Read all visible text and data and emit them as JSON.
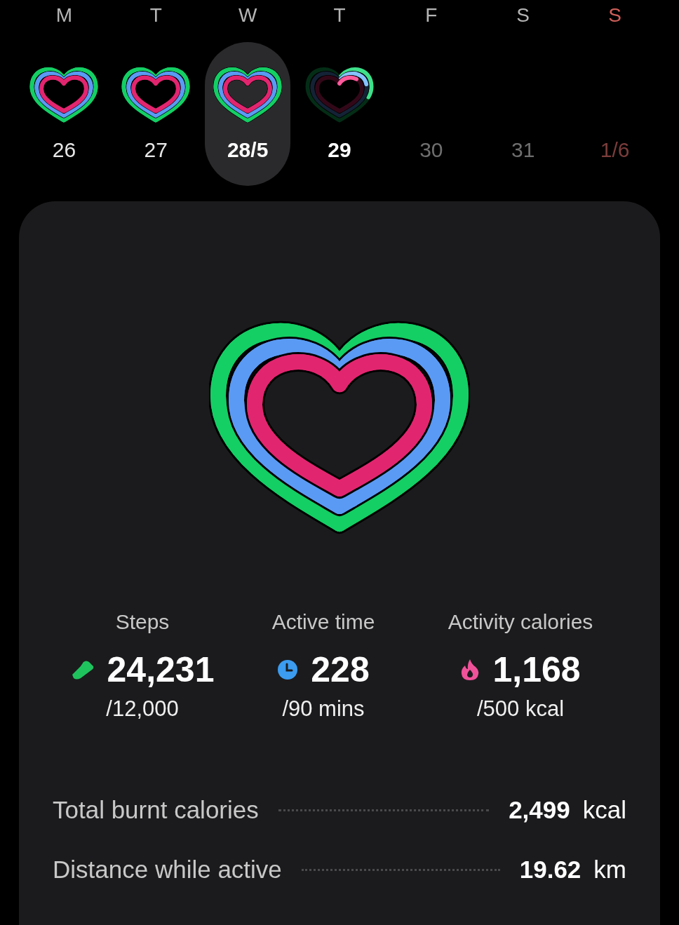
{
  "days": [
    {
      "letter": "M",
      "date": "26",
      "kind": "past",
      "selected": false,
      "holiday": false
    },
    {
      "letter": "T",
      "date": "27",
      "kind": "past",
      "selected": false,
      "holiday": false
    },
    {
      "letter": "W",
      "date": "28/5",
      "kind": "past",
      "selected": true,
      "holiday": false
    },
    {
      "letter": "T",
      "date": "29",
      "kind": "today",
      "selected": false,
      "holiday": false
    },
    {
      "letter": "F",
      "date": "30",
      "kind": "future",
      "selected": false,
      "holiday": false
    },
    {
      "letter": "S",
      "date": "31",
      "kind": "future",
      "selected": false,
      "holiday": false
    },
    {
      "letter": "S",
      "date": "1/6",
      "kind": "future",
      "selected": false,
      "holiday": true
    }
  ],
  "summary": {
    "stats": [
      {
        "kind": "steps",
        "label": "Steps",
        "value": "24,231",
        "goal": "/12,000"
      },
      {
        "kind": "time",
        "label": "Active time",
        "value": "228",
        "goal": "/90 mins"
      },
      {
        "kind": "calories",
        "label": "Activity calories",
        "value": "1,168",
        "goal": "/500 kcal"
      }
    ],
    "details": [
      {
        "label": "Total burnt calories",
        "value": "2,499",
        "unit": "kcal"
      },
      {
        "label": "Distance while active",
        "value": "19.62",
        "unit": "km"
      }
    ]
  }
}
